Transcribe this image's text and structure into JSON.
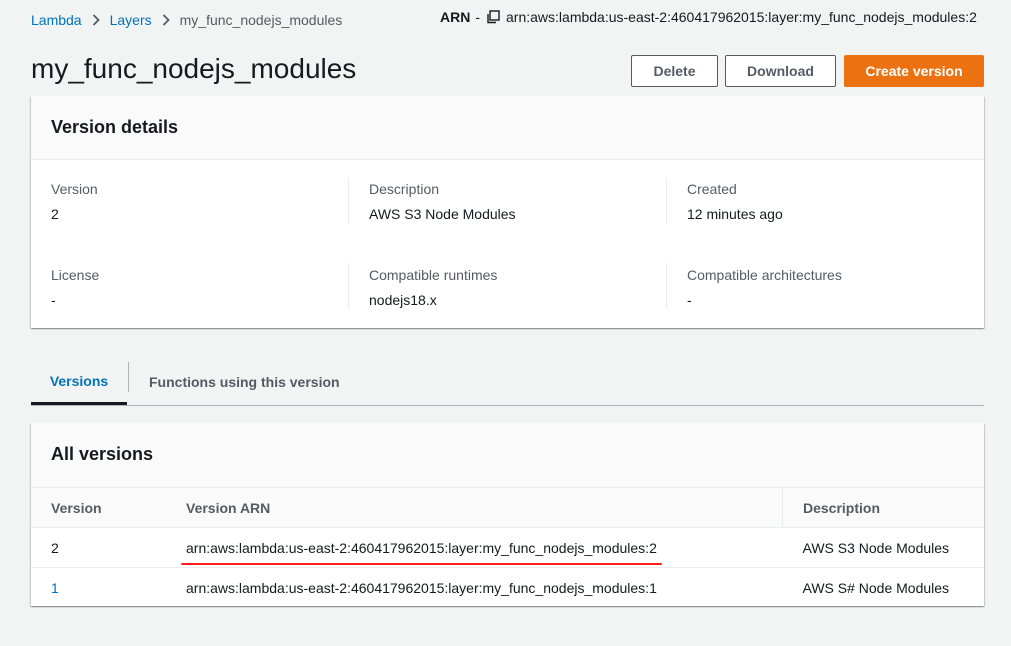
{
  "breadcrumb": {
    "items": [
      "Lambda",
      "Layers"
    ],
    "current": "my_func_nodejs_modules"
  },
  "arn": {
    "label": "ARN",
    "dash": "-",
    "value": "arn:aws:lambda:us-east-2:460417962015:layer:my_func_nodejs_modules:2"
  },
  "page_title": "my_func_nodejs_modules",
  "buttons": {
    "delete": "Delete",
    "download": "Download",
    "create": "Create version"
  },
  "details": {
    "title": "Version details",
    "fields": [
      {
        "label": "Version",
        "value": "2"
      },
      {
        "label": "Description",
        "value": "AWS S3 Node Modules"
      },
      {
        "label": "Created",
        "value": "12 minutes ago"
      },
      {
        "label": "License",
        "value": "-"
      },
      {
        "label": "Compatible runtimes",
        "value": "nodejs18.x"
      },
      {
        "label": "Compatible architectures",
        "value": "-"
      }
    ]
  },
  "tabs": [
    "Versions",
    "Functions using this version"
  ],
  "versions": {
    "title": "All versions",
    "columns": [
      "Version",
      "Version ARN",
      "Description"
    ],
    "rows": [
      {
        "version": "2",
        "arn": "arn:aws:lambda:us-east-2:460417962015:layer:my_func_nodejs_modules:2",
        "description": "AWS S3 Node Modules"
      },
      {
        "version": "1",
        "arn": "arn:aws:lambda:us-east-2:460417962015:layer:my_func_nodejs_modules:1",
        "description": "AWS S# Node Modules"
      }
    ]
  },
  "colors": {
    "link": "#0073bb",
    "primary": "#ec7211",
    "highlight": "#ff1f1f"
  },
  "icons": {
    "separator": "chevron-right-icon",
    "copy": "copy-icon"
  }
}
